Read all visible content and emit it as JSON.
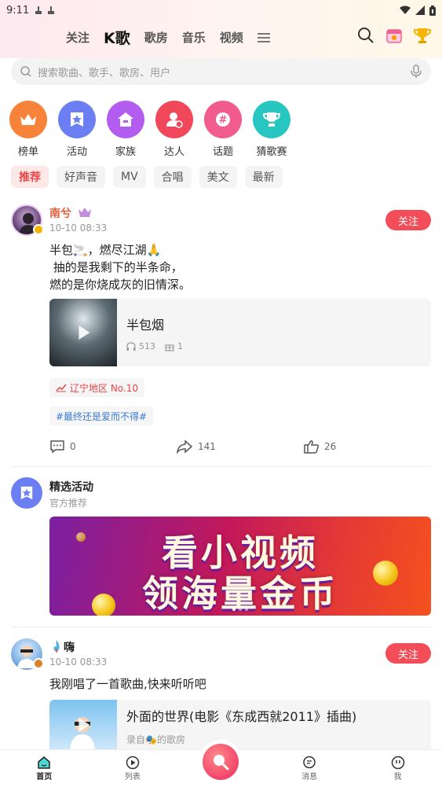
{
  "status_bar": {
    "time": "9:11"
  },
  "header": {
    "tabs": [
      {
        "label": "关注",
        "active": false
      },
      {
        "label": "K歌",
        "active": true
      },
      {
        "label": "歌房",
        "active": false
      },
      {
        "label": "音乐",
        "active": false
      },
      {
        "label": "视频",
        "active": false
      }
    ]
  },
  "search": {
    "placeholder": "搜索歌曲、歌手、歌房、用户"
  },
  "categories": [
    {
      "label": "榜单",
      "icon": "crown-icon",
      "color": "#f7833a"
    },
    {
      "label": "活动",
      "icon": "star-ticket-icon",
      "color": "#6b7ff2"
    },
    {
      "label": "家族",
      "icon": "home-icon",
      "color": "#b25cf0"
    },
    {
      "label": "达人",
      "icon": "user-badge-icon",
      "color": "#f0485a"
    },
    {
      "label": "话题",
      "icon": "hashtag-icon",
      "color": "#f25b8e"
    },
    {
      "label": "猜歌赛",
      "icon": "trophy-icon",
      "color": "#27c6c0"
    }
  ],
  "filters": [
    {
      "label": "推荐",
      "active": true
    },
    {
      "label": "好声音",
      "active": false
    },
    {
      "label": "MV",
      "active": false
    },
    {
      "label": "合唱",
      "active": false
    },
    {
      "label": "美文",
      "active": false
    },
    {
      "label": "最新",
      "active": false
    }
  ],
  "post1": {
    "username": "南兮",
    "time": "10-10 08:33",
    "follow_label": "关注",
    "text": "半包🚬，燃尽江湖🙏\n 抽的是我剩下的半条命，\n燃的是你烧成灰的旧情深。",
    "song_title": "半包烟",
    "listens": "513",
    "gifts": "1",
    "rank_tag": "辽宁地区 No.10",
    "topic_tag": "#最终还是爱而不得#",
    "comments": "0",
    "shares": "141",
    "likes": "26"
  },
  "activity": {
    "title": "精选活动",
    "subtitle": "官方推荐",
    "banner_line1": "看小视频",
    "banner_line2": "领海量金币"
  },
  "post2": {
    "username": "嗨",
    "time": "10-10 08:33",
    "follow_label": "关注",
    "text": "我刚唱了一首歌曲,快来听听吧",
    "song_title": "外面的世界(电影《东成西就2011》插曲)",
    "song_sub": "录自🎭的歌房"
  },
  "bottom_nav": {
    "items": [
      {
        "label": "首页",
        "active": true
      },
      {
        "label": "列表",
        "active": false
      },
      {
        "label": "",
        "active": false
      },
      {
        "label": "消息",
        "active": false
      },
      {
        "label": "我",
        "active": false
      }
    ]
  },
  "colors": {
    "accent": "#f24d58",
    "active_filter": "#e84545",
    "rank_tag": "#e84545",
    "topic_tag": "#3a7bd5"
  }
}
